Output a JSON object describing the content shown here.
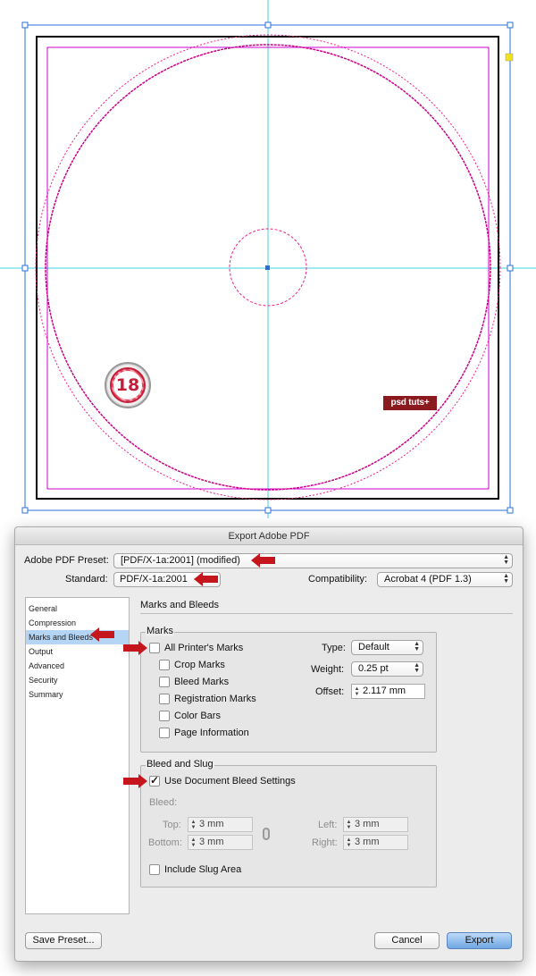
{
  "canvas": {
    "badge_number": "18",
    "logo_text": "psd tuts+",
    "colors": {
      "guide": "#3fd0e6",
      "margin": "#cc00cc",
      "circle": "#ee2288",
      "frame": "#2b6fd6"
    }
  },
  "dialog": {
    "title": "Export Adobe PDF",
    "preset_label": "Adobe PDF Preset:",
    "preset_value": "[PDF/X-1a:2001] (modified)",
    "standard_label": "Standard:",
    "standard_value": "PDF/X-1a:2001",
    "compat_label": "Compatibility:",
    "compat_value": "Acrobat 4 (PDF 1.3)",
    "sidebar": {
      "items": [
        "General",
        "Compression",
        "Marks and Bleeds",
        "Output",
        "Advanced",
        "Security",
        "Summary"
      ],
      "selected": "Marks and Bleeds"
    },
    "section_title": "Marks and Bleeds",
    "marks": {
      "group_label": "Marks",
      "all_label": "All Printer's Marks",
      "crop": "Crop Marks",
      "bleed": "Bleed Marks",
      "registration": "Registration Marks",
      "color_bars": "Color Bars",
      "page_info": "Page Information",
      "type_label": "Type:",
      "type_value": "Default",
      "weight_label": "Weight:",
      "weight_value": "0.25 pt",
      "offset_label": "Offset:",
      "offset_value": "2.117 mm"
    },
    "bleed_slug": {
      "group_label": "Bleed and Slug",
      "use_doc_label": "Use Document Bleed Settings",
      "use_doc_checked": true,
      "bleed_label": "Bleed:",
      "top_label": "Top:",
      "top_value": "3 mm",
      "bottom_label": "Bottom:",
      "bottom_value": "3 mm",
      "left_label": "Left:",
      "left_value": "3 mm",
      "right_label": "Right:",
      "right_value": "3 mm",
      "slug_label": "Include Slug Area"
    },
    "buttons": {
      "save_preset": "Save Preset...",
      "cancel": "Cancel",
      "export": "Export"
    }
  }
}
